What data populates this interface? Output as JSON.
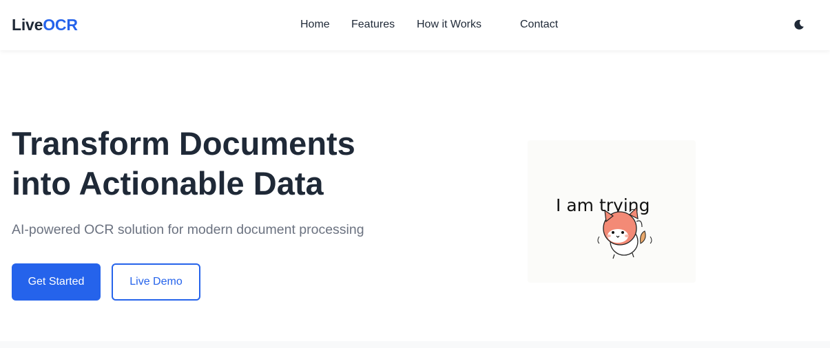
{
  "brand": {
    "name_part1": "Live",
    "name_part2": "OCR",
    "accent_color": "#2563eb"
  },
  "nav": {
    "items": [
      {
        "label": "Home"
      },
      {
        "label": "Features"
      },
      {
        "label": "How it Works"
      },
      {
        "label": "Contact"
      }
    ],
    "theme_toggle_icon": "moon-icon"
  },
  "hero": {
    "title_line1": "Transform Documents",
    "title_line2": "into Actionable Data",
    "subtitle": "AI-powered OCR solution for modern document processing",
    "primary_button": "Get Started",
    "secondary_button": "Live Demo",
    "image": {
      "caption": "I am trying",
      "alt_icon": "cartoon-dog-sticker"
    }
  },
  "colors": {
    "primary": "#2563eb",
    "text_dark": "#1f2937",
    "text_muted": "#6b7280"
  }
}
